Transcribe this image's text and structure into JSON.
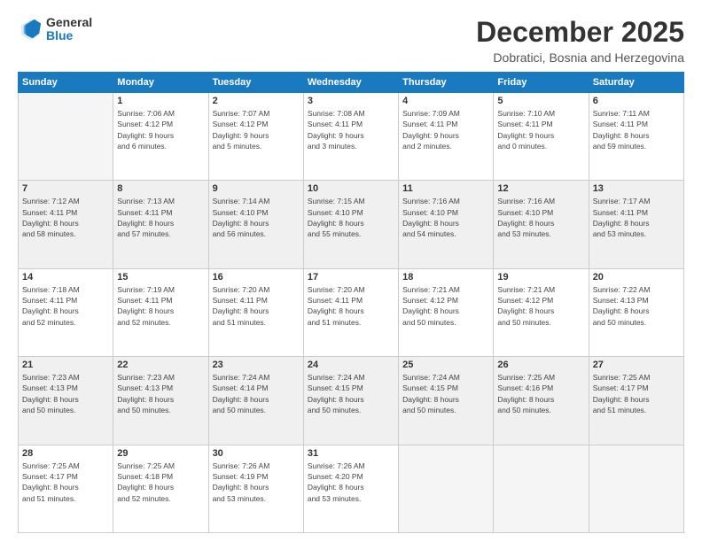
{
  "logo": {
    "general": "General",
    "blue": "Blue"
  },
  "title": "December 2025",
  "subtitle": "Dobratici, Bosnia and Herzegovina",
  "weekdays": [
    "Sunday",
    "Monday",
    "Tuesday",
    "Wednesday",
    "Thursday",
    "Friday",
    "Saturday"
  ],
  "weeks": [
    [
      {
        "day": null,
        "info": null
      },
      {
        "day": "1",
        "info": "Sunrise: 7:06 AM\nSunset: 4:12 PM\nDaylight: 9 hours\nand 6 minutes."
      },
      {
        "day": "2",
        "info": "Sunrise: 7:07 AM\nSunset: 4:12 PM\nDaylight: 9 hours\nand 5 minutes."
      },
      {
        "day": "3",
        "info": "Sunrise: 7:08 AM\nSunset: 4:11 PM\nDaylight: 9 hours\nand 3 minutes."
      },
      {
        "day": "4",
        "info": "Sunrise: 7:09 AM\nSunset: 4:11 PM\nDaylight: 9 hours\nand 2 minutes."
      },
      {
        "day": "5",
        "info": "Sunrise: 7:10 AM\nSunset: 4:11 PM\nDaylight: 9 hours\nand 0 minutes."
      },
      {
        "day": "6",
        "info": "Sunrise: 7:11 AM\nSunset: 4:11 PM\nDaylight: 8 hours\nand 59 minutes."
      }
    ],
    [
      {
        "day": "7",
        "info": "Sunrise: 7:12 AM\nSunset: 4:11 PM\nDaylight: 8 hours\nand 58 minutes."
      },
      {
        "day": "8",
        "info": "Sunrise: 7:13 AM\nSunset: 4:11 PM\nDaylight: 8 hours\nand 57 minutes."
      },
      {
        "day": "9",
        "info": "Sunrise: 7:14 AM\nSunset: 4:10 PM\nDaylight: 8 hours\nand 56 minutes."
      },
      {
        "day": "10",
        "info": "Sunrise: 7:15 AM\nSunset: 4:10 PM\nDaylight: 8 hours\nand 55 minutes."
      },
      {
        "day": "11",
        "info": "Sunrise: 7:16 AM\nSunset: 4:10 PM\nDaylight: 8 hours\nand 54 minutes."
      },
      {
        "day": "12",
        "info": "Sunrise: 7:16 AM\nSunset: 4:10 PM\nDaylight: 8 hours\nand 53 minutes."
      },
      {
        "day": "13",
        "info": "Sunrise: 7:17 AM\nSunset: 4:11 PM\nDaylight: 8 hours\nand 53 minutes."
      }
    ],
    [
      {
        "day": "14",
        "info": "Sunrise: 7:18 AM\nSunset: 4:11 PM\nDaylight: 8 hours\nand 52 minutes."
      },
      {
        "day": "15",
        "info": "Sunrise: 7:19 AM\nSunset: 4:11 PM\nDaylight: 8 hours\nand 52 minutes."
      },
      {
        "day": "16",
        "info": "Sunrise: 7:20 AM\nSunset: 4:11 PM\nDaylight: 8 hours\nand 51 minutes."
      },
      {
        "day": "17",
        "info": "Sunrise: 7:20 AM\nSunset: 4:11 PM\nDaylight: 8 hours\nand 51 minutes."
      },
      {
        "day": "18",
        "info": "Sunrise: 7:21 AM\nSunset: 4:12 PM\nDaylight: 8 hours\nand 50 minutes."
      },
      {
        "day": "19",
        "info": "Sunrise: 7:21 AM\nSunset: 4:12 PM\nDaylight: 8 hours\nand 50 minutes."
      },
      {
        "day": "20",
        "info": "Sunrise: 7:22 AM\nSunset: 4:13 PM\nDaylight: 8 hours\nand 50 minutes."
      }
    ],
    [
      {
        "day": "21",
        "info": "Sunrise: 7:23 AM\nSunset: 4:13 PM\nDaylight: 8 hours\nand 50 minutes."
      },
      {
        "day": "22",
        "info": "Sunrise: 7:23 AM\nSunset: 4:13 PM\nDaylight: 8 hours\nand 50 minutes."
      },
      {
        "day": "23",
        "info": "Sunrise: 7:24 AM\nSunset: 4:14 PM\nDaylight: 8 hours\nand 50 minutes."
      },
      {
        "day": "24",
        "info": "Sunrise: 7:24 AM\nSunset: 4:15 PM\nDaylight: 8 hours\nand 50 minutes."
      },
      {
        "day": "25",
        "info": "Sunrise: 7:24 AM\nSunset: 4:15 PM\nDaylight: 8 hours\nand 50 minutes."
      },
      {
        "day": "26",
        "info": "Sunrise: 7:25 AM\nSunset: 4:16 PM\nDaylight: 8 hours\nand 50 minutes."
      },
      {
        "day": "27",
        "info": "Sunrise: 7:25 AM\nSunset: 4:17 PM\nDaylight: 8 hours\nand 51 minutes."
      }
    ],
    [
      {
        "day": "28",
        "info": "Sunrise: 7:25 AM\nSunset: 4:17 PM\nDaylight: 8 hours\nand 51 minutes."
      },
      {
        "day": "29",
        "info": "Sunrise: 7:25 AM\nSunset: 4:18 PM\nDaylight: 8 hours\nand 52 minutes."
      },
      {
        "day": "30",
        "info": "Sunrise: 7:26 AM\nSunset: 4:19 PM\nDaylight: 8 hours\nand 53 minutes."
      },
      {
        "day": "31",
        "info": "Sunrise: 7:26 AM\nSunset: 4:20 PM\nDaylight: 8 hours\nand 53 minutes."
      },
      {
        "day": null,
        "info": null
      },
      {
        "day": null,
        "info": null
      },
      {
        "day": null,
        "info": null
      }
    ]
  ]
}
